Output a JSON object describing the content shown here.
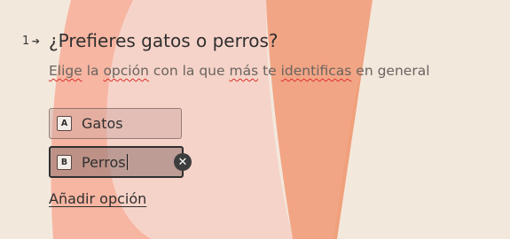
{
  "question": {
    "number": "1",
    "arrow_icon": "arrow-right-icon",
    "title": "¿Prefieres gatos o perros?",
    "description_parts": [
      "Elige",
      " la ",
      "opción",
      " con la que ",
      "más",
      " te ",
      "identificas",
      " en general"
    ]
  },
  "options": [
    {
      "key": "A",
      "label": "Gatos"
    },
    {
      "key": "B",
      "label": "Perros"
    }
  ],
  "remove_icon": "close-icon",
  "remove_symbol": "✕",
  "add_option_label": "Añadir opción",
  "colors": {
    "background": "#f3e8dc",
    "shape_light": "#f4cfc4",
    "shape_mid": "#f7b09b",
    "shape_dark": "#f2a582"
  }
}
